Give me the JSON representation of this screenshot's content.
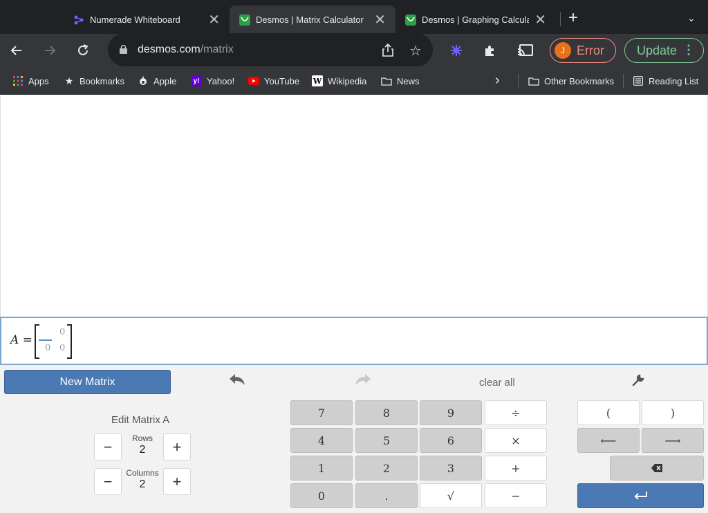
{
  "browser": {
    "tabs": [
      {
        "title": "Numerade Whiteboard",
        "close": "✕"
      },
      {
        "title": "Desmos | Matrix Calculator",
        "close": "✕"
      },
      {
        "title": "Desmos | Graphing Calculato",
        "close": "✕"
      }
    ],
    "new_tab": "+",
    "tab_menu": "⌄",
    "url_host": "desmos.com",
    "url_path": "/matrix",
    "profile_initial": "J",
    "profile_status": "Error",
    "update_label": "Update",
    "bookmarks": [
      "Apps",
      "Bookmarks",
      "Apple",
      "Yahoo!",
      "YouTube",
      "Wikipedia",
      "News"
    ],
    "bookmarks_overflow": "›",
    "other_bookmarks": "Other Bookmarks",
    "reading_list": "Reading List",
    "accent_colors": {
      "error": "#f28b82",
      "update": "#81c995",
      "avatar": "#e8711a"
    }
  },
  "matrix": {
    "name": "A",
    "equals": "=",
    "cells": [
      [
        "",
        "0"
      ],
      [
        "0",
        "0"
      ]
    ]
  },
  "keypad": {
    "new_matrix": "New Matrix",
    "clear_all": "clear all",
    "edit_title": "Edit Matrix A",
    "rows_label": "Rows",
    "rows_value": "2",
    "columns_label": "Columns",
    "columns_value": "2",
    "minus": "−",
    "plus": "+",
    "num_keys": [
      [
        "7",
        "8",
        "9",
        "÷"
      ],
      [
        "4",
        "5",
        "6",
        "×"
      ],
      [
        "1",
        "2",
        "3",
        "+"
      ],
      [
        "0",
        ".",
        "√",
        "−"
      ]
    ],
    "paren_open": "(",
    "paren_close": ")",
    "arrow_left": "⟵",
    "arrow_right": "⟶",
    "accent_color": "#4a79b3"
  }
}
